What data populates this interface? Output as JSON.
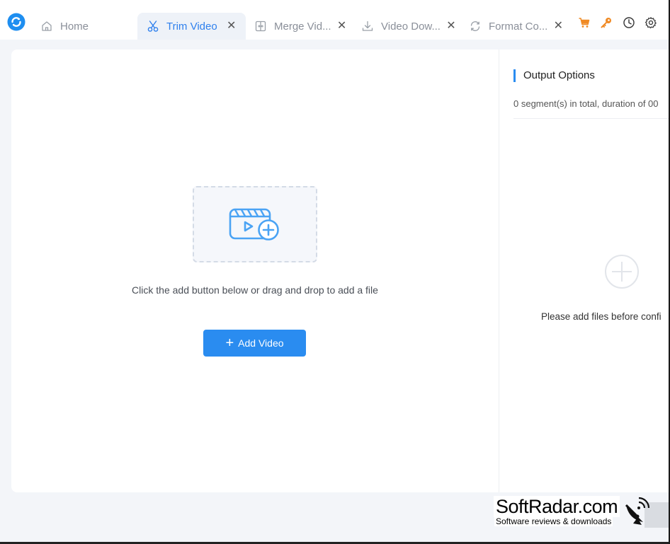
{
  "tabs": [
    {
      "label": "Home",
      "icon": "home-icon",
      "active": false,
      "closable": false
    },
    {
      "label": "Trim Video",
      "icon": "scissors-icon",
      "active": true,
      "closable": true
    },
    {
      "label": "Merge Vid...",
      "icon": "merge-icon",
      "active": false,
      "closable": true
    },
    {
      "label": "Video Dow...",
      "icon": "download-icon",
      "active": false,
      "closable": true
    },
    {
      "label": "Format Co...",
      "icon": "convert-icon",
      "active": false,
      "closable": true
    }
  ],
  "toolbar": {
    "icons": [
      "cart-icon",
      "key-icon",
      "history-icon",
      "settings-icon"
    ]
  },
  "main": {
    "drop_hint": "Click the add button below or drag and drop to add a file",
    "add_button": "Add Video"
  },
  "output": {
    "title": "Output Options",
    "summary": "0 segment(s) in total, duration of 00",
    "empty_hint": "Please add files before confi"
  },
  "watermark": {
    "name": "SoftRadar.com",
    "tagline": "Software reviews & downloads"
  },
  "colors": {
    "accent": "#2a8cf0",
    "tab_active_bg": "#eef2f8",
    "cart": "#f08a24",
    "key": "#f08a24"
  }
}
